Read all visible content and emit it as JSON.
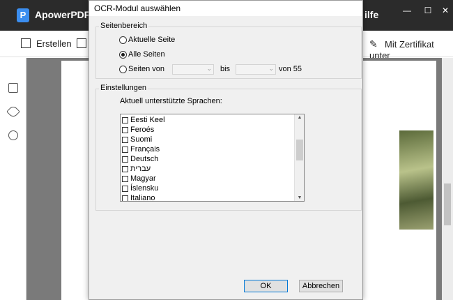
{
  "app": {
    "logo_letter": "P",
    "title": "ApowerPDF",
    "menu_partial": "ilfe",
    "window_controls": [
      "—",
      "☐",
      "✕"
    ]
  },
  "toolbar": {
    "create_label": "Erstellen",
    "certificate_label": "Mit Zertifikat unter"
  },
  "sidebar": {
    "icons": [
      "pages-icon",
      "tag-icon",
      "search-icon"
    ]
  },
  "dialog": {
    "title": "OCR-Modul auswählen",
    "page_range": {
      "label": "Seitenbereich",
      "current_page": "Aktuelle Seite",
      "all_pages": "Alle Seiten",
      "pages_from": "Seiten von",
      "to": "bis",
      "of_total": "von 55",
      "selected": "all_pages"
    },
    "settings": {
      "label": "Einstellungen",
      "languages_label": "Aktuell unterstützte Sprachen:",
      "languages": [
        "Eesti Keel",
        "Feroés",
        "Suomi",
        "Français",
        "Deutsch",
        "עברית",
        "Magyar",
        "Íslensku",
        "Italiano"
      ]
    },
    "ok_label": "OK",
    "cancel_label": "Abbrechen"
  }
}
